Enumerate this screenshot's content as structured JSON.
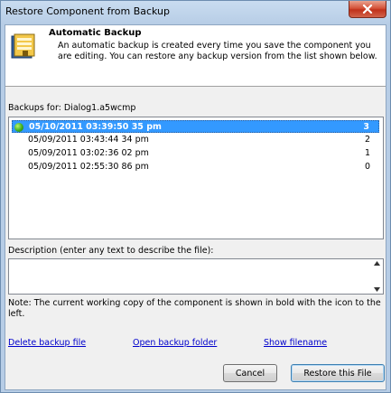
{
  "window": {
    "title": "Restore Component from Backup"
  },
  "header": {
    "title": "Automatic Backup",
    "text": "An automatic backup is created every time you save the component you are editing. You can restore any backup version from the list shown below."
  },
  "backups": {
    "label": "Backups for:  Dialog1.a5wcmp",
    "rows": [
      {
        "date": "05/10/2011 03:39:50 35 pm",
        "num": "3"
      },
      {
        "date": "05/09/2011 03:43:44 34 pm",
        "num": "2"
      },
      {
        "date": "05/09/2011 03:02:36 02 pm",
        "num": "1"
      },
      {
        "date": "05/09/2011 02:55:30 86 pm",
        "num": "0"
      }
    ],
    "selected_index": 0,
    "current_icon": "green-dot-icon"
  },
  "description": {
    "label": "Description (enter any text to describe the file):",
    "value": ""
  },
  "note": "Note: The current working copy of the component is shown in bold with the icon to the left.",
  "links": {
    "delete": "Delete backup file",
    "open_folder": "Open backup folder",
    "show_filename": "Show filename"
  },
  "buttons": {
    "cancel": "Cancel",
    "restore": "Restore this File"
  },
  "colors": {
    "selection": "#3399ff",
    "link": "#0000cc",
    "close_button": "#c7402a"
  }
}
